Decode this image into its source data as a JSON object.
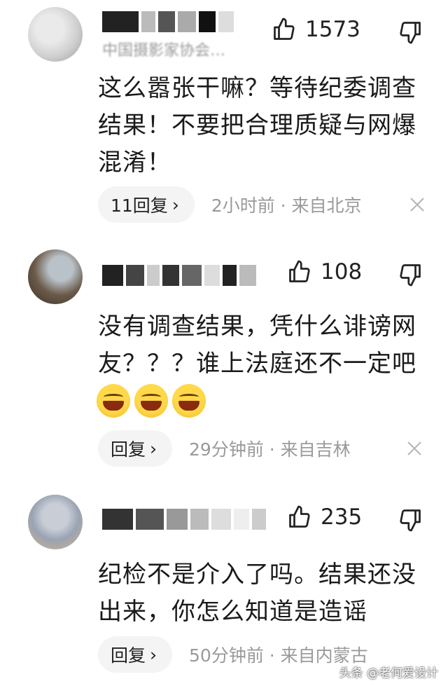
{
  "comments": [
    {
      "author_sub": "中国摄影家协会…",
      "likes": "1573",
      "text": "这么嚣张干嘛？等待纪委调查\n结果！不要把合理质疑与网爆\n混淆！",
      "reply_label": "11回复",
      "reply_chevron": "›",
      "meta": "2小时前 · 来自北京"
    },
    {
      "likes": "108",
      "text": "没有调查结果，凭什么诽谤网\n友？？？谁上法庭还不一定吧",
      "emoji_count": 3,
      "reply_label": "回复",
      "reply_chevron": "›",
      "meta": "29分钟前 · 来自吉林"
    },
    {
      "likes": "235",
      "text": "纪检不是介入了吗。结果还没\n出来，你怎么知道是造谣",
      "reply_label": "回复",
      "reply_chevron": "›",
      "meta": "50分钟前 · 来自内蒙古"
    }
  ],
  "watermark": {
    "text": "头条 @老何爱设计"
  },
  "icons": {
    "like": "thumbs-up-icon",
    "dislike": "thumbs-down-icon",
    "close": "close-icon",
    "emoji": "laughing-emoji-icon"
  }
}
